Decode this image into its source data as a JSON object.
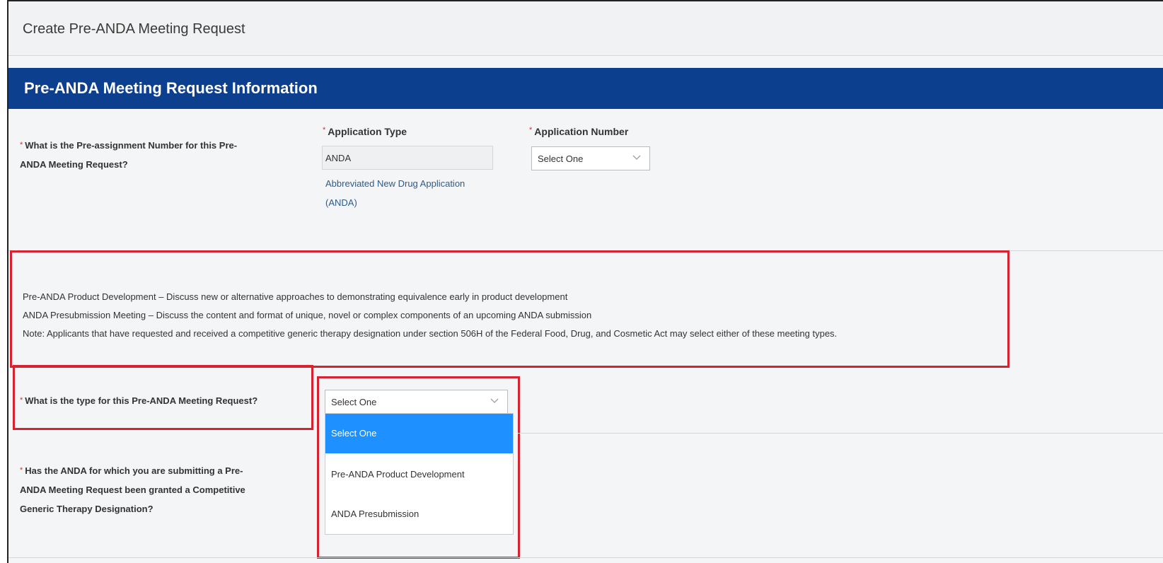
{
  "header": {
    "title": "Create Pre-ANDA Meeting Request"
  },
  "section": {
    "title": "Pre-ANDA Meeting Request Information"
  },
  "required_marker": "*",
  "pre_assignment": {
    "question_line1": "What is the Pre-assignment Number for this Pre-",
    "question_line2": "ANDA Meeting Request?",
    "application_type": {
      "label": "Application Type",
      "value": "ANDA",
      "help_line1": "Abbreviated New Drug Application",
      "help_line2": "(ANDA)"
    },
    "application_number": {
      "label": "Application Number",
      "selected": "Select One"
    }
  },
  "info": {
    "line1": "Pre-ANDA Product Development – Discuss new or alternative approaches to demonstrating equivalence early in product development",
    "line2": "ANDA Presubmission Meeting – Discuss the content and format of unique, novel or complex components of an upcoming ANDA submission",
    "line3": "Note: Applicants that have requested and received a competitive generic therapy designation under section 506H of the Federal Food, Drug, and Cosmetic Act may select either of these meeting types."
  },
  "meeting_type": {
    "question": "What is the type for this Pre-ANDA Meeting Request?",
    "selected": "Select One",
    "options": [
      "Select One",
      "Pre-ANDA Product Development",
      "ANDA Presubmission"
    ]
  },
  "cgt": {
    "question_line1": "Has the ANDA for which you are submitting a Pre-",
    "question_line2": "ANDA Meeting Request been granted a Competitive",
    "question_line3": "Generic Therapy Designation?"
  },
  "icons": {
    "dropdown": "chevron-down-icon"
  },
  "colors": {
    "section_bar": "#0d3f8f",
    "highlight_box": "#d6232f",
    "option_highlight": "#1e90ff",
    "required": "#c23934"
  }
}
